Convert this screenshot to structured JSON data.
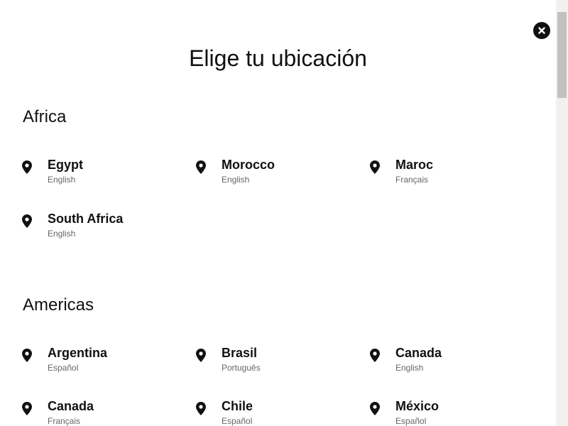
{
  "modal": {
    "title": "Elige tu ubicación",
    "close_icon": "close-icon"
  },
  "regions": [
    {
      "name": "Africa",
      "locations": [
        {
          "country": "Egypt",
          "language": "English"
        },
        {
          "country": "Morocco",
          "language": "English"
        },
        {
          "country": "Maroc",
          "language": "Français"
        },
        {
          "country": "South Africa",
          "language": "English"
        }
      ]
    },
    {
      "name": "Americas",
      "locations": [
        {
          "country": "Argentina",
          "language": "Español"
        },
        {
          "country": "Brasil",
          "language": "Português"
        },
        {
          "country": "Canada",
          "language": "English"
        },
        {
          "country": "Canada",
          "language": "Français"
        },
        {
          "country": "Chile",
          "language": "Español"
        },
        {
          "country": "México",
          "language": "Español"
        }
      ]
    }
  ],
  "icons": {
    "location": "map-pin-icon"
  },
  "colors": {
    "text": "#111111",
    "secondary_text": "#666666",
    "background": "#ffffff"
  }
}
